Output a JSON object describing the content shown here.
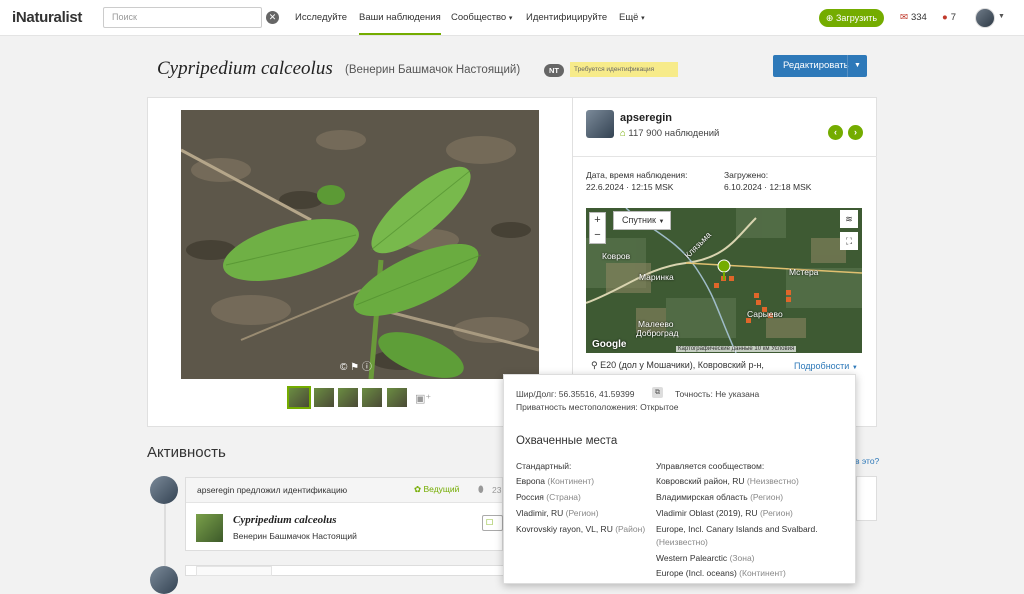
{
  "header": {
    "logo": "iNaturalist",
    "search_placeholder": "Поиск",
    "nav": [
      "Исследуйте",
      "Ваши наблюдения",
      "Сообщество",
      "Идентифицируйте",
      "Ещё"
    ],
    "upload_label": "Загрузить",
    "messages_count": "334",
    "notifications_count": "7"
  },
  "observation": {
    "scientific_name": "Cypripedium calceolus",
    "common_name": "(Венерин Башмачок Настоящий)",
    "status_badge": "NT",
    "quality_label": "Требуется идентификация",
    "edit_label": "Редактировать"
  },
  "observer": {
    "name": "apseregin",
    "count": "117 900 наблюдений"
  },
  "dates": {
    "observed_label": "Дата, время наблюдения:",
    "observed_value": "22.6.2024 · 12:15 MSK",
    "uploaded_label": "Загружено:",
    "uploaded_value": "6.10.2024 · 12:18 MSK"
  },
  "map": {
    "type_label": "Спутник",
    "labels": [
      "Ковров",
      "Клязьма",
      "Мстера",
      "Сарыево",
      "Малеево",
      "Доброград",
      "Маринка"
    ],
    "google": "Google",
    "footer": "Картографические данные  10 км  Условия",
    "place": "E20 (дол у Мошачики), Ковровский р-н,",
    "more_link": "Подробности"
  },
  "popup": {
    "coords": "Шир/Долг: 56.35516, 41.59399",
    "accuracy": "Точность: Не указана",
    "privacy": "Приватность местоположения: Открытое",
    "title": "Охваченные места",
    "standard_head": "Стандартный:",
    "community_head": "Управляется сообществом:",
    "standard": [
      {
        "name": "Европа",
        "type": "(Континент)"
      },
      {
        "name": "Россия",
        "type": "(Страна)"
      },
      {
        "name": "Vladimir, RU",
        "type": "(Регион)"
      },
      {
        "name": "Kovrovskiy rayon, VL, RU",
        "type": "(Район)"
      }
    ],
    "community": [
      {
        "name": "Ковровский район, RU",
        "type": "(Неизвестно)"
      },
      {
        "name": "Владимирская область",
        "type": "(Регион)"
      },
      {
        "name": "Vladimir Oblast (2019), RU",
        "type": "(Регион)"
      },
      {
        "name": "Europe, Incl. Canary Islands and Svalbard.",
        "type": ""
      },
      {
        "name": "",
        "type": "(Неизвестно)"
      },
      {
        "name": "Western Palearctic",
        "type": "(Зона)"
      },
      {
        "name": "Europe (Incl. oceans)",
        "type": "(Континент)"
      }
    ]
  },
  "activity": {
    "title": "Активность",
    "help_link": "в это?",
    "user_text": "apseregin предложил идентификацию",
    "leading_label": "Ведущий",
    "count": "23",
    "sci_name": "Cypripedium calceolus",
    "common_name": "Венерин Башмачок Настоящий"
  }
}
